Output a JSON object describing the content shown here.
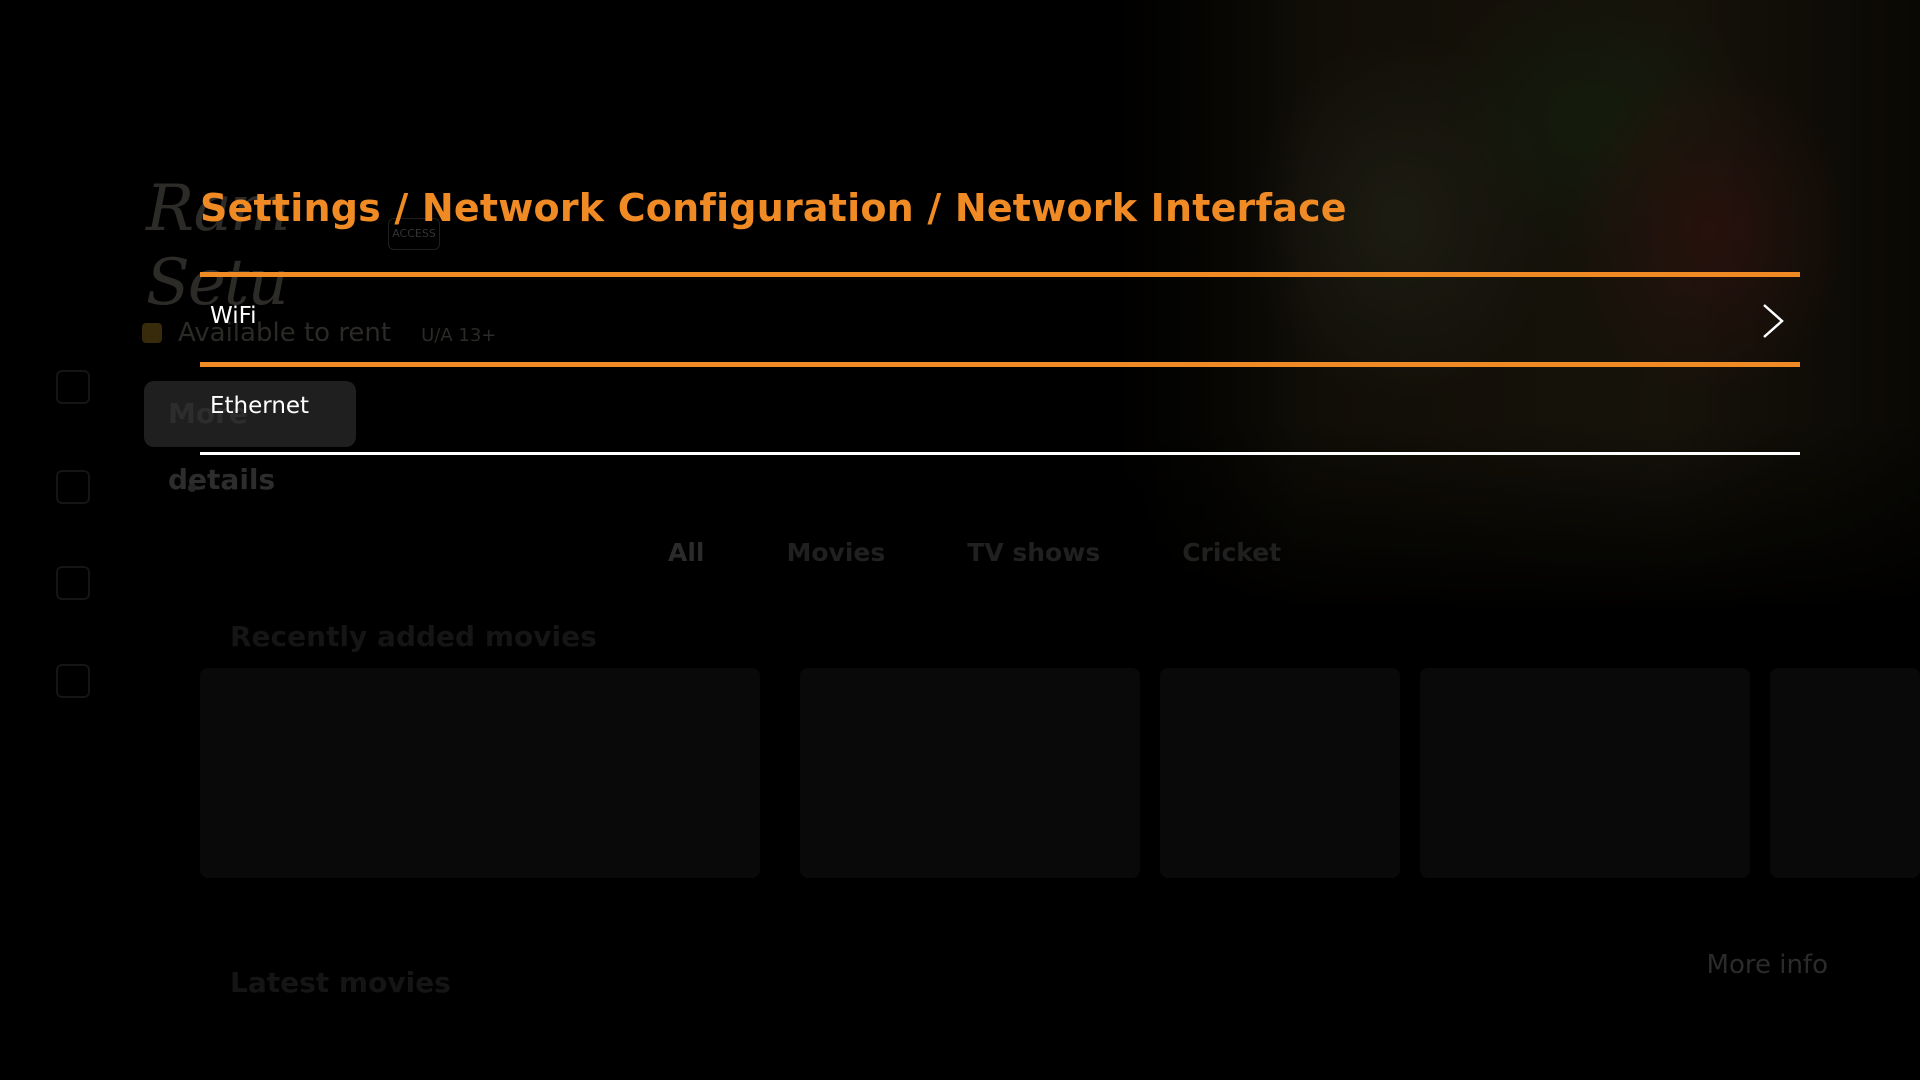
{
  "background": {
    "logo_text": "Ram Setu",
    "logo_badge": "ACCESS",
    "rent_label": "Available to rent",
    "rating": "U/A 13+",
    "more_details": "More details",
    "tabs": [
      "All",
      "Movies",
      "TV shows",
      "Cricket"
    ],
    "row1_title": "Recently added movies",
    "row2_title": "Latest movies",
    "more_info": "More info"
  },
  "settings": {
    "breadcrumb": "Settings / Network Configuration / Network Interface",
    "items": [
      {
        "label": "WiFi",
        "focused": true,
        "icon": "chevron-right-icon"
      },
      {
        "label": "Ethernet",
        "focused": false
      }
    ]
  },
  "colors": {
    "accent": "#f08a24",
    "background": "#000000",
    "text": "#ffffff"
  }
}
